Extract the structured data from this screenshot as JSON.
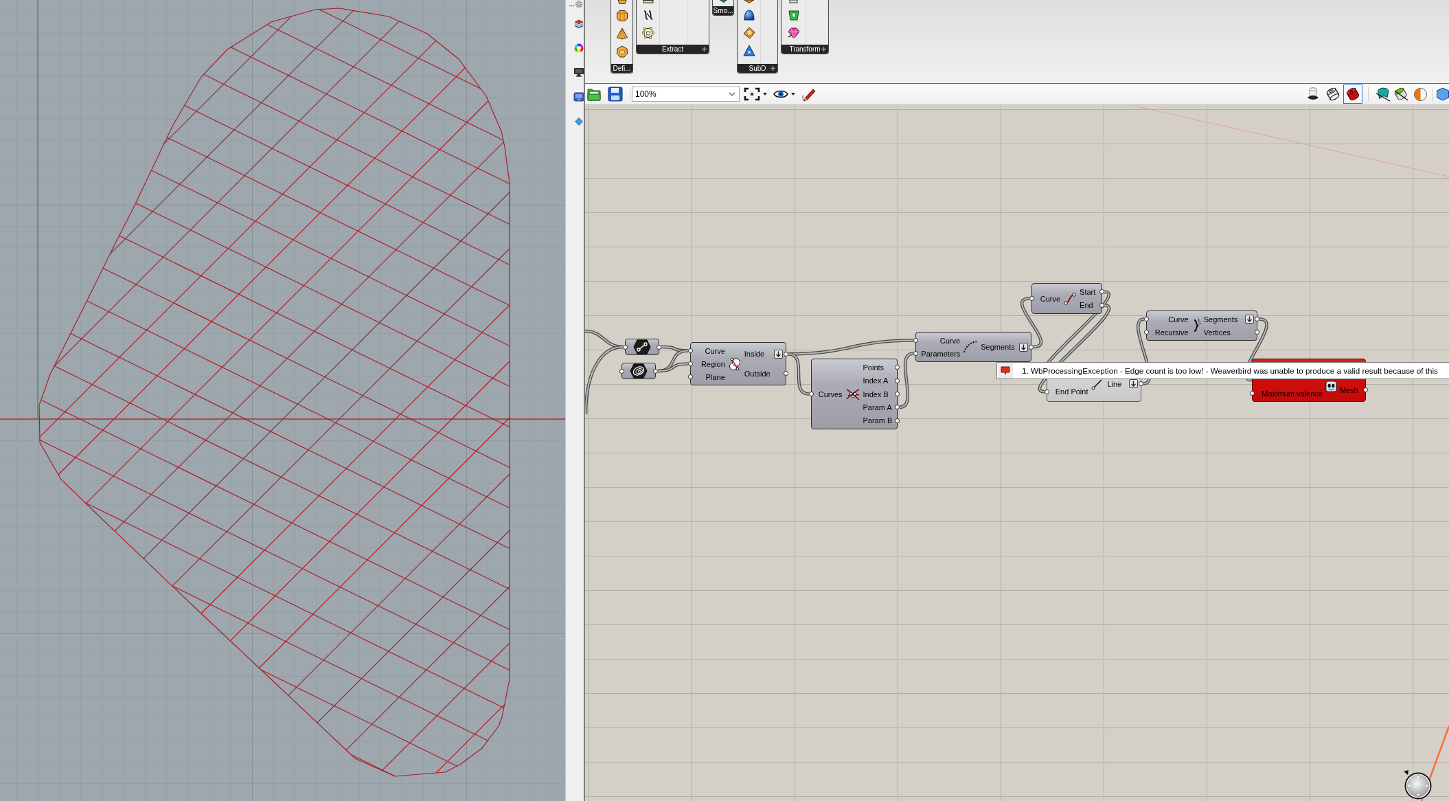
{
  "ribbon": {
    "panels": [
      {
        "label": "Defi...",
        "expandable": false
      },
      {
        "label": "Extract",
        "expandable": true
      },
      {
        "label": "Smo...",
        "expandable": false
      },
      {
        "label": "SubD",
        "expandable": true
      },
      {
        "label": "Transform",
        "expandable": true
      }
    ]
  },
  "toolbar": {
    "zoom": {
      "value": "100%"
    },
    "preview_modes": [
      {
        "kind": "ghosted",
        "selected": false
      },
      {
        "kind": "wireframe",
        "selected": false
      },
      {
        "kind": "shaded",
        "selected": true
      }
    ]
  },
  "canvas": {
    "nodes": [
      {
        "kind": "param",
        "preview": true,
        "error": false
      },
      {
        "kind": "param",
        "preview": true,
        "error": false
      },
      {
        "kind": "component",
        "preview": true,
        "error": false,
        "inputs": [
          {
            "label": "Curve"
          },
          {
            "label": "Region"
          },
          {
            "label": "Plane"
          }
        ],
        "outputs": [
          {
            "label": "Inside",
            "flatten": true
          },
          {
            "label": "Outside",
            "flatten": false
          }
        ]
      },
      {
        "kind": "component",
        "preview": true,
        "error": false,
        "inputs": [
          {
            "label": "Curves"
          }
        ],
        "outputs": [
          {
            "label": "Points",
            "flatten": false
          },
          {
            "label": "Index A",
            "flatten": false
          },
          {
            "label": "Index B",
            "flatten": false
          },
          {
            "label": "Param A",
            "flatten": false
          },
          {
            "label": "Param B",
            "flatten": false
          }
        ]
      },
      {
        "kind": "component",
        "preview": true,
        "error": false,
        "inputs": [
          {
            "label": "Curve"
          },
          {
            "label": "Parameters"
          }
        ],
        "outputs": [
          {
            "label": "Segments",
            "flatten": true
          }
        ]
      },
      {
        "kind": "component",
        "preview": true,
        "error": false,
        "inputs": [
          {
            "label": "Curve"
          }
        ],
        "outputs": [
          {
            "label": "Start",
            "flatten": false
          },
          {
            "label": "End",
            "flatten": false
          }
        ]
      },
      {
        "kind": "component",
        "preview": true,
        "error": false,
        "inputs": [
          {
            "label": "Curve"
          },
          {
            "label": "Recursive"
          }
        ],
        "outputs": [
          {
            "label": "Segments",
            "flatten": true
          },
          {
            "label": "Vertices",
            "flatten": false
          }
        ]
      },
      {
        "kind": "component",
        "preview": false,
        "error": false,
        "inputs": [
          {
            "label": "End Point"
          }
        ],
        "outputs": [
          {
            "label": "Line",
            "flatten": true
          }
        ]
      },
      {
        "kind": "component",
        "preview": true,
        "error": true,
        "inputs": [
          {
            "label": "Maximum valence"
          }
        ],
        "outputs": [
          {
            "label": "Mesh",
            "flatten": false
          }
        ]
      }
    ],
    "error_tooltip": {
      "text": "1. WbProcessingException - Edge count is too low! - Weaverbird was unable to produce a valid result because of this"
    }
  }
}
